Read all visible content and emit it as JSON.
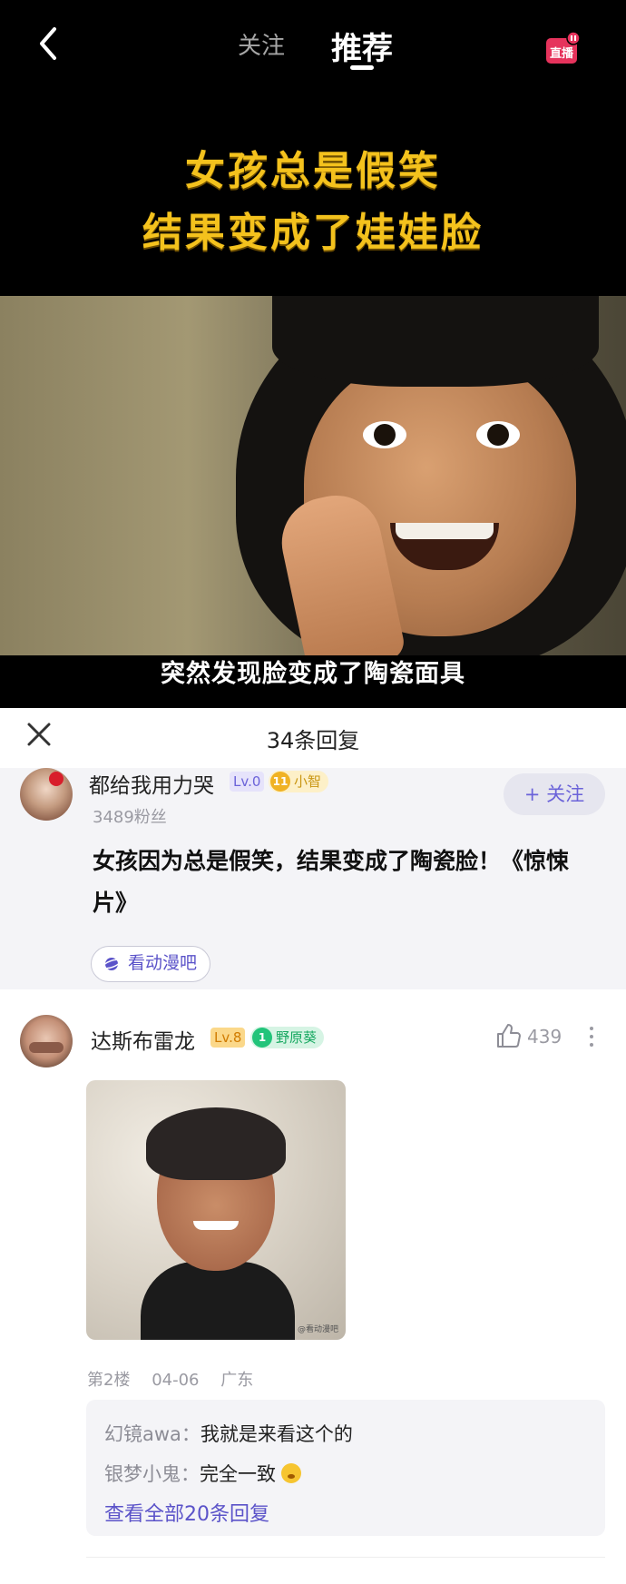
{
  "topbar": {
    "tabs": [
      {
        "label": "关注",
        "active": false
      },
      {
        "label": "推荐",
        "active": true
      }
    ],
    "live_label": "直播"
  },
  "video": {
    "headline_lines": [
      "女孩总是假笑",
      "结果变成了娃娃脸"
    ],
    "caption": "突然发现脸变成了陶瓷面具"
  },
  "reply_header": {
    "title": "34条回复"
  },
  "post": {
    "username": "都给我用力哭",
    "level": "Lv.0",
    "tag_number": "11",
    "tag_label": "小智",
    "fans": "3489粉丝",
    "follow_label": "+ 关注",
    "text": "女孩因为总是假笑，结果变成了陶瓷脸！《惊悚片》",
    "bar_chip": "看动漫吧"
  },
  "comment": {
    "username": "达斯布雷龙",
    "level": "Lv.8",
    "tag_number": "1",
    "tag_label": "野原葵",
    "likes": "439",
    "image_watermark": "@看动漫吧",
    "floor": "第2楼",
    "date": "04-06",
    "location": "广东",
    "replies": [
      {
        "user": "幻镜awa：",
        "text": "我就是来看这个的"
      },
      {
        "user": "银梦小鬼：",
        "text": "完全一致"
      }
    ],
    "view_all": "查看全部20条回复"
  },
  "colors": {
    "headline": "#f4c21d",
    "accent": "#5b53c9",
    "level_lv0_bg": "#e6e3fb",
    "level_lv8_bg": "#fbd88a",
    "tag_gold": "#f0b224",
    "tag_green": "#22c47a"
  }
}
